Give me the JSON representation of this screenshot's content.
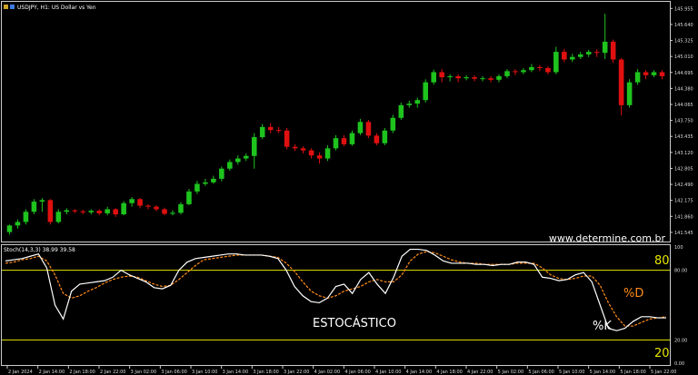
{
  "window": {
    "symbol_title": "USDJPY, H1:  US Dollar vs Yen",
    "indicator_title": "Stoch(14,3,3) 38.99 39.58"
  },
  "watermark": "www.determine.com.br",
  "annotations": {
    "indicator_name": "ESTOCÁSTICO",
    "k_label": "%K",
    "d_label": "%D",
    "level_high": "80",
    "level_low": "20"
  },
  "colors": {
    "background": "#000000",
    "bull": "#1ec31e",
    "bear": "#e01010",
    "k_line": "#ffffff",
    "d_line": "#ff8c1a",
    "level_line": "#e6e600",
    "grid_border": "#cccccc"
  },
  "chart_data": [
    {
      "type": "candlestick",
      "title": "USDJPY, H1:  US Dollar vs Yen",
      "y_ticks": [
        "145.955",
        "145.640",
        "145.325",
        "145.010",
        "144.695",
        "144.380",
        "144.065",
        "143.750",
        "143.435",
        "143.120",
        "142.805",
        "142.490",
        "142.175",
        "141.860",
        "141.545"
      ],
      "ylim": [
        141.4,
        146.05
      ],
      "x_ticks": [
        "2 Jan 2024",
        "2 Jan 14:00",
        "2 Jan 18:00",
        "2 Jan 22:00",
        "3 Jan 02:00",
        "3 Jan 06:00",
        "3 Jan 10:00",
        "3 Jan 14:00",
        "3 Jan 18:00",
        "3 Jan 22:00",
        "4 Jan 02:00",
        "4 Jan 06:00",
        "4 Jan 10:00",
        "4 Jan 14:00",
        "4 Jan 18:00",
        "4 Jan 22:00",
        "5 Jan 02:00",
        "5 Jan 06:00",
        "5 Jan 10:00",
        "5 Jan 14:00",
        "5 Jan 18:00",
        "5 Jan 22:00"
      ],
      "candles": [
        [
          141.55,
          141.68,
          141.5,
          141.7
        ],
        [
          141.68,
          141.75,
          141.62,
          141.8
        ],
        [
          141.75,
          141.95,
          141.7,
          142.0
        ],
        [
          141.95,
          142.15,
          141.9,
          142.2
        ],
        [
          142.15,
          142.18,
          141.95,
          142.22
        ],
        [
          142.18,
          141.75,
          141.7,
          142.2
        ],
        [
          141.75,
          141.95,
          141.72,
          142.0
        ],
        [
          141.95,
          141.98,
          141.9,
          142.02
        ],
        [
          141.98,
          141.96,
          141.92,
          142.0
        ],
        [
          141.96,
          141.94,
          141.9,
          141.99
        ],
        [
          141.94,
          141.97,
          141.9,
          142.0
        ],
        [
          141.97,
          141.92,
          141.88,
          142.0
        ],
        [
          141.92,
          142.0,
          141.88,
          142.05
        ],
        [
          142.0,
          141.9,
          141.85,
          142.02
        ],
        [
          141.9,
          142.12,
          141.88,
          142.16
        ],
        [
          142.12,
          142.2,
          142.05,
          142.24
        ],
        [
          142.2,
          142.07,
          142.02,
          142.22
        ],
        [
          142.07,
          142.05,
          142.0,
          142.1
        ],
        [
          142.05,
          142.0,
          141.96,
          142.08
        ],
        [
          142.0,
          141.91,
          141.88,
          142.03
        ],
        [
          141.91,
          141.93,
          141.88,
          141.98
        ],
        [
          141.93,
          142.1,
          141.9,
          142.14
        ],
        [
          142.1,
          142.35,
          142.08,
          142.4
        ],
        [
          142.35,
          142.5,
          142.3,
          142.56
        ],
        [
          142.5,
          142.53,
          142.46,
          142.6
        ],
        [
          142.53,
          142.6,
          142.5,
          142.66
        ],
        [
          142.6,
          142.8,
          142.55,
          142.84
        ],
        [
          142.8,
          142.93,
          142.76,
          142.98
        ],
        [
          142.93,
          143.0,
          142.88,
          143.06
        ],
        [
          143.0,
          143.05,
          142.95,
          143.1
        ],
        [
          143.05,
          143.42,
          142.8,
          143.5
        ],
        [
          143.42,
          143.62,
          143.38,
          143.68
        ],
        [
          143.62,
          143.56,
          143.5,
          143.7
        ],
        [
          143.56,
          143.55,
          143.5,
          143.62
        ],
        [
          143.55,
          143.23,
          143.18,
          143.6
        ],
        [
          143.23,
          143.2,
          143.15,
          143.28
        ],
        [
          143.2,
          143.16,
          143.1,
          143.24
        ],
        [
          143.16,
          143.06,
          143.0,
          143.2
        ],
        [
          143.06,
          143.0,
          142.9,
          143.12
        ],
        [
          143.0,
          143.2,
          142.95,
          143.26
        ],
        [
          143.2,
          143.4,
          143.16,
          143.46
        ],
        [
          143.4,
          143.28,
          143.24,
          143.46
        ],
        [
          143.28,
          143.5,
          143.25,
          143.55
        ],
        [
          143.5,
          143.72,
          143.46,
          143.78
        ],
        [
          143.72,
          143.45,
          143.4,
          143.76
        ],
        [
          143.45,
          143.3,
          143.26,
          143.5
        ],
        [
          143.3,
          143.55,
          143.26,
          143.6
        ],
        [
          143.55,
          143.8,
          143.5,
          143.86
        ],
        [
          143.8,
          144.05,
          143.76,
          144.1
        ],
        [
          144.05,
          144.08,
          144.0,
          144.14
        ],
        [
          144.08,
          144.15,
          144.0,
          144.2
        ],
        [
          144.15,
          144.5,
          144.1,
          144.56
        ],
        [
          144.5,
          144.7,
          144.45,
          144.75
        ],
        [
          144.7,
          144.6,
          144.5,
          144.76
        ],
        [
          144.6,
          144.62,
          144.52,
          144.66
        ],
        [
          144.62,
          144.58,
          144.5,
          144.66
        ],
        [
          144.58,
          144.6,
          144.54,
          144.64
        ],
        [
          144.6,
          144.57,
          144.52,
          144.64
        ],
        [
          144.57,
          144.58,
          144.52,
          144.62
        ],
        [
          144.58,
          144.55,
          144.5,
          144.62
        ],
        [
          144.55,
          144.62,
          144.5,
          144.66
        ],
        [
          144.62,
          144.72,
          144.58,
          144.76
        ],
        [
          144.72,
          144.7,
          144.64,
          144.76
        ],
        [
          144.7,
          144.74,
          144.66,
          144.78
        ],
        [
          144.74,
          144.8,
          144.7,
          144.86
        ],
        [
          144.8,
          144.78,
          144.72,
          144.84
        ],
        [
          144.78,
          144.7,
          144.66,
          144.82
        ],
        [
          144.7,
          145.1,
          144.66,
          145.2
        ],
        [
          145.1,
          144.95,
          144.9,
          145.16
        ],
        [
          144.95,
          145.0,
          144.9,
          145.06
        ],
        [
          145.0,
          145.05,
          144.96,
          145.1
        ],
        [
          145.05,
          145.1,
          145.0,
          145.14
        ],
        [
          145.1,
          145.08,
          145.0,
          145.15
        ],
        [
          145.08,
          145.3,
          144.96,
          145.85
        ],
        [
          145.3,
          144.95,
          144.88,
          145.34
        ],
        [
          144.95,
          144.05,
          143.85,
          144.98
        ],
        [
          144.05,
          144.5,
          144.0,
          144.56
        ],
        [
          144.5,
          144.7,
          144.45,
          144.76
        ],
        [
          144.7,
          144.64,
          144.56,
          144.74
        ],
        [
          144.64,
          144.7,
          144.6,
          144.74
        ],
        [
          144.7,
          144.62,
          144.56,
          144.74
        ]
      ]
    },
    {
      "type": "line",
      "title": "Stoch(14,3,3) 38.99 39.58",
      "ylim": [
        0,
        100
      ],
      "levels": [
        80,
        20
      ],
      "series": [
        {
          "name": "%K",
          "values": [
            88,
            89,
            90,
            92,
            94,
            82,
            50,
            38,
            62,
            68,
            69,
            70,
            71,
            74,
            80,
            76,
            73,
            70,
            65,
            64,
            67,
            80,
            87,
            90,
            91,
            92,
            93,
            94,
            94,
            93,
            93,
            93,
            92,
            90,
            80,
            66,
            58,
            53,
            52,
            56,
            66,
            68,
            60,
            72,
            78,
            68,
            60,
            74,
            92,
            98,
            98,
            97,
            93,
            88,
            86,
            86,
            86,
            85,
            85,
            84,
            85,
            85,
            87,
            87,
            85,
            74,
            73,
            71,
            72,
            76,
            78,
            70,
            50,
            30,
            28,
            30,
            36,
            40,
            40,
            39,
            39
          ]
        },
        {
          "name": "%D",
          "values": [
            86,
            87,
            89,
            90,
            92,
            88,
            76,
            60,
            56,
            58,
            62,
            65,
            69,
            72,
            74,
            75,
            74,
            71,
            68,
            66,
            67,
            72,
            78,
            84,
            89,
            90,
            91,
            92,
            93,
            93,
            93,
            93,
            92,
            91,
            86,
            79,
            70,
            62,
            58,
            56,
            58,
            62,
            64,
            66,
            70,
            72,
            70,
            70,
            76,
            88,
            94,
            96,
            95,
            92,
            89,
            87,
            86,
            86,
            85,
            85,
            85,
            85,
            86,
            86,
            86,
            82,
            76,
            73,
            72,
            73,
            75,
            75,
            67,
            52,
            40,
            32,
            32,
            35,
            38,
            39,
            40
          ]
        }
      ]
    }
  ]
}
